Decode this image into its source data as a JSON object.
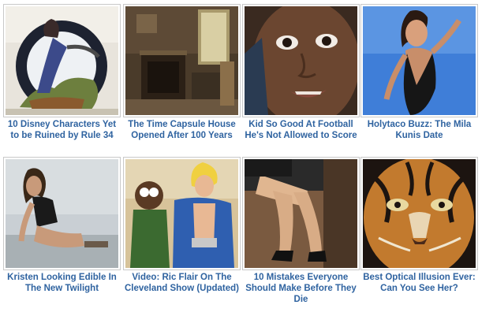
{
  "tiles": [
    {
      "title": "10 Disney Characters Yet to be Ruined by Rule 34",
      "image": "cartoon-heron-character-thumbnail"
    },
    {
      "title": "The Time Capsule House Opened After 100 Years",
      "image": "victorian-room-interior-thumbnail"
    },
    {
      "title": "Kid So Good At Football He's Not Allowed to Score",
      "image": "boy-face-closeup-thumbnail"
    },
    {
      "title": "Holytaco Buzz: The Mila Kunis Date",
      "image": "woman-black-outfit-thumbnail"
    },
    {
      "title": "Kristen Looking Edible In The New Twilight",
      "image": "woman-kneeling-photo-thumbnail"
    },
    {
      "title": "Video: Ric Flair On The Cleveland Show (Updated)",
      "image": "cartoon-wrestler-thumbnail"
    },
    {
      "title": "10 Mistakes Everyone Should Make Before They Die",
      "image": "legs-in-heels-thumbnail"
    },
    {
      "title": "Best Optical Illusion Ever: Can You See Her?",
      "image": "tiger-face-illusion-thumbnail"
    }
  ]
}
